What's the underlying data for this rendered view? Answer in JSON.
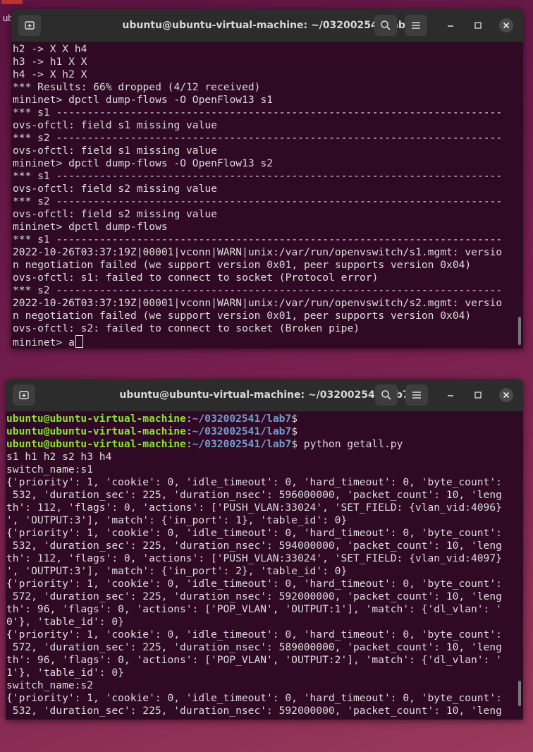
{
  "desktop": {
    "label_ub": "ub"
  },
  "terminal1": {
    "title": "ubuntu@ubuntu-virtual-machine: ~/032002541/lab7",
    "lines": [
      "h2 -> X X h4",
      "h3 -> h1 X X",
      "h4 -> X h2 X",
      "*** Results: 66% dropped (4/12 received)",
      "mininet> dpctl dump-flows -O OpenFlow13 s1",
      "*** s1 ------------------------------------------------------------------------",
      "ovs-ofctl: field s1 missing value",
      "*** s2 ------------------------------------------------------------------------",
      "ovs-ofctl: field s1 missing value",
      "mininet> dpctl dump-flows -O OpenFlow13 s2",
      "*** s1 ------------------------------------------------------------------------",
      "ovs-ofctl: field s2 missing value",
      "*** s2 ------------------------------------------------------------------------",
      "ovs-ofctl: field s2 missing value",
      "mininet> dpctl dump-flows",
      "*** s1 ------------------------------------------------------------------------",
      "2022-10-26T03:37:19Z|00001|vconn|WARN|unix:/var/run/openvswitch/s1.mgmt: versio",
      "n negotiation failed (we support version 0x01, peer supports version 0x04)",
      "ovs-ofctl: s1: failed to connect to socket (Protocol error)",
      "*** s2 ------------------------------------------------------------------------",
      "2022-10-26T03:37:19Z|00001|vconn|WARN|unix:/var/run/openvswitch/s2.mgmt: versio",
      "n negotiation failed (we support version 0x01, peer supports version 0x04)",
      "ovs-ofctl: s2: failed to connect to socket (Broken pipe)"
    ],
    "prompt": "mininet> a"
  },
  "terminal2": {
    "title": "ubuntu@ubuntu-virtual-machine: ~/032002541/lab7",
    "prompt_user": "ubuntu@ubuntu-virtual-machine",
    "prompt_sep": ":",
    "prompt_path": "~/032002541/lab7",
    "prompt_dollar": "$",
    "commands": [
      "",
      "",
      " python getall.py"
    ],
    "lines": [
      "s1 h1 h2 s2 h3 h4",
      "switch_name:s1",
      "{'priority': 1, 'cookie': 0, 'idle_timeout': 0, 'hard_timeout': 0, 'byte_count':",
      " 532, 'duration_sec': 225, 'duration_nsec': 596000000, 'packet_count': 10, 'leng",
      "th': 112, 'flags': 0, 'actions': ['PUSH_VLAN:33024', 'SET_FIELD: {vlan_vid:4096}",
      "', 'OUTPUT:3'], 'match': {'in_port': 1}, 'table_id': 0}",
      "{'priority': 1, 'cookie': 0, 'idle_timeout': 0, 'hard_timeout': 0, 'byte_count':",
      " 532, 'duration_sec': 225, 'duration_nsec': 594000000, 'packet_count': 10, 'leng",
      "th': 112, 'flags': 0, 'actions': ['PUSH_VLAN:33024', 'SET_FIELD: {vlan_vid:4097}",
      "', 'OUTPUT:3'], 'match': {'in_port': 2}, 'table_id': 0}",
      "{'priority': 1, 'cookie': 0, 'idle_timeout': 0, 'hard_timeout': 0, 'byte_count':",
      " 572, 'duration_sec': 225, 'duration_nsec': 592000000, 'packet_count': 10, 'leng",
      "th': 96, 'flags': 0, 'actions': ['POP_VLAN', 'OUTPUT:1'], 'match': {'dl_vlan': '",
      "0'}, 'table_id': 0}",
      "{'priority': 1, 'cookie': 0, 'idle_timeout': 0, 'hard_timeout': 0, 'byte_count':",
      " 572, 'duration_sec': 225, 'duration_nsec': 589000000, 'packet_count': 10, 'leng",
      "th': 96, 'flags': 0, 'actions': ['POP_VLAN', 'OUTPUT:2'], 'match': {'dl_vlan': '",
      "1'}, 'table_id': 0}",
      "switch_name:s2",
      "{'priority': 1, 'cookie': 0, 'idle_timeout': 0, 'hard_timeout': 0, 'byte_count':",
      " 532, 'duration_sec': 225, 'duration_nsec': 592000000, 'packet_count': 10, 'leng"
    ]
  },
  "colors": {
    "terminal_bg": "#300a24",
    "titlebar_bg": "#2c2c2c",
    "prompt_user": "#8ae234",
    "prompt_path": "#729fcf"
  },
  "icons": {
    "new_tab": "new-tab-icon",
    "search": "search-icon",
    "menu": "hamburger-menu-icon",
    "minimize": "minimize-icon",
    "maximize": "maximize-icon",
    "close": "close-icon"
  }
}
